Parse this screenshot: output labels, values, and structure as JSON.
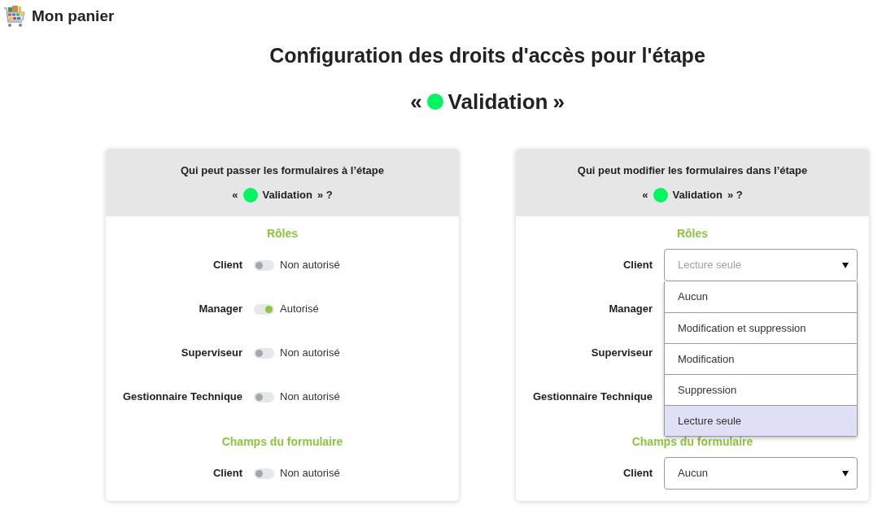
{
  "header": {
    "title": "Mon panier"
  },
  "heading": {
    "title": "Configuration des droits d'accès pour l'étape",
    "step": {
      "open_quote": "«",
      "color": "#00f562",
      "name": "Validation",
      "close_quote": "»"
    }
  },
  "panels": [
    {
      "kind": "toggles",
      "title": "Qui peut passer les formulaires à l’étape",
      "step": {
        "open_quote": "«",
        "color": "#00f562",
        "name": "Validation",
        "close_quote": "» ?"
      },
      "sections": [
        {
          "title": "Rôles",
          "rows": [
            {
              "label": "Client",
              "on": false,
              "status": "Non autorisé"
            },
            {
              "label": "Manager",
              "on": true,
              "status": "Autorisé"
            },
            {
              "label": "Superviseur",
              "on": false,
              "status": "Non autorisé"
            },
            {
              "label": "Gestionnaire Technique",
              "on": false,
              "status": "Non autorisé"
            }
          ]
        },
        {
          "title": "Champs du formulaire",
          "rows": [
            {
              "label": "Client",
              "on": false,
              "status": "Non autorisé"
            }
          ]
        }
      ]
    },
    {
      "kind": "selects",
      "title": "Qui peut modifier les formulaires dans l’étape",
      "step": {
        "open_quote": "«",
        "color": "#00f562",
        "name": "Validation",
        "close_quote": "» ?"
      },
      "sections": [
        {
          "title": "Rôles",
          "rows": [
            {
              "label": "Client",
              "value": "Lecture seule",
              "expanded": true,
              "options": [
                {
                  "label": "Aucun",
                  "selected": false
                },
                {
                  "label": "Modification et suppression",
                  "selected": false
                },
                {
                  "label": "Modification",
                  "selected": false
                },
                {
                  "label": "Suppression",
                  "selected": false
                },
                {
                  "label": "Lecture seule",
                  "selected": true
                }
              ]
            },
            {
              "label": "Manager"
            },
            {
              "label": "Superviseur"
            },
            {
              "label": "Gestionnaire Technique"
            }
          ]
        },
        {
          "title": "Champs du formulaire",
          "rows": [
            {
              "label": "Client",
              "value": "Aucun",
              "expanded": false
            }
          ]
        }
      ]
    }
  ]
}
